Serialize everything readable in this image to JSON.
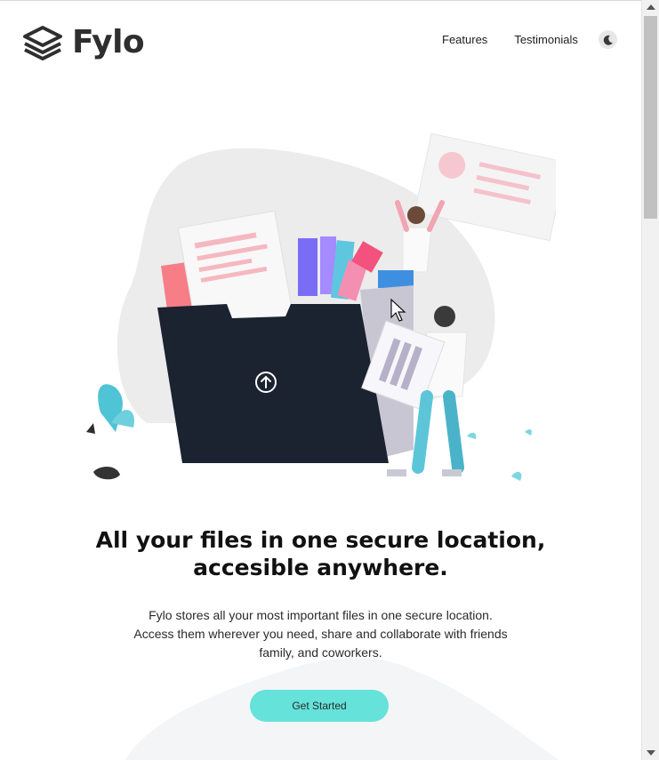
{
  "header": {
    "logo_text": "Fylo",
    "logo_icon": "stacked-layers-icon",
    "nav": [
      {
        "label": "Features"
      },
      {
        "label": "Testimonials"
      }
    ],
    "theme_toggle_icon": "moon-icon"
  },
  "hero": {
    "illustration_icon": "upload-arrow-icon",
    "headline_line1": "All your files in one secure location,",
    "headline_line2": "accesible anywhere.",
    "description_line1": "Fylo stores all your most important files in one secure location.",
    "description_line2": "Access them wherever you need, share and collaborate with friends",
    "description_line3": "family, and coworkers.",
    "cta_label": "Get Started"
  },
  "colors": {
    "accent": "#65e2d9",
    "folder": "#1b2230",
    "text": "#111111"
  }
}
